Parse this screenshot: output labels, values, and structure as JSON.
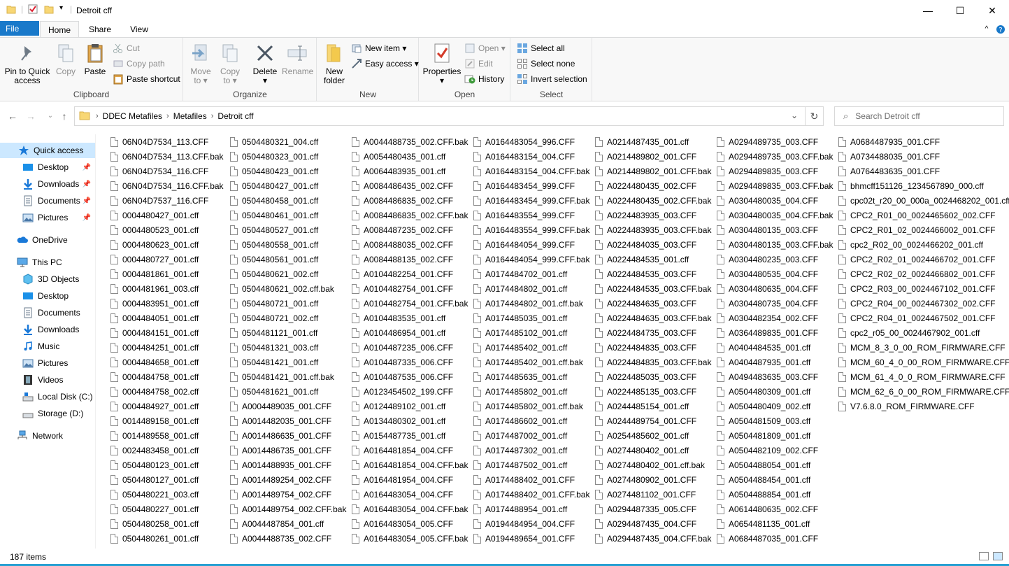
{
  "window": {
    "title": "Detroit cff",
    "minimize": "—",
    "maximize": "☐",
    "close": "✕"
  },
  "tabs": {
    "file": "File",
    "home": "Home",
    "share": "Share",
    "view": "View"
  },
  "ribbon": {
    "clipboard": {
      "label": "Clipboard",
      "pin_line1": "Pin to Quick",
      "pin_line2": "access",
      "copy": "Copy",
      "paste": "Paste",
      "cut": "Cut",
      "copy_path": "Copy path",
      "paste_shortcut": "Paste shortcut"
    },
    "organize": {
      "label": "Organize",
      "move_to_line1": "Move",
      "move_to_line2": "to ▾",
      "copy_to_line1": "Copy",
      "copy_to_line2": "to ▾",
      "delete": "Delete",
      "delete_arrow": "▾",
      "rename": "Rename"
    },
    "new": {
      "label": "New",
      "new_folder_line1": "New",
      "new_folder_line2": "folder",
      "new_item": "New item ▾",
      "easy_access": "Easy access ▾"
    },
    "open": {
      "label": "Open",
      "properties": "Properties",
      "properties_arrow": "▾",
      "open": "Open ▾",
      "edit": "Edit",
      "history": "History"
    },
    "select": {
      "label": "Select",
      "select_all": "Select all",
      "select_none": "Select none",
      "invert_selection": "Invert selection"
    }
  },
  "address": {
    "crumbs": [
      "DDEC Metafiles",
      "Metafiles",
      "Detroit cff"
    ]
  },
  "search": {
    "placeholder": "Search Detroit cff"
  },
  "nav": {
    "quick_access": "Quick access",
    "desktop": "Desktop",
    "downloads": "Downloads",
    "documents": "Documents",
    "pictures": "Pictures",
    "onedrive": "OneDrive",
    "this_pc": "This PC",
    "objects3d": "3D Objects",
    "desktop2": "Desktop",
    "documents2": "Documents",
    "downloads2": "Downloads",
    "music": "Music",
    "pictures2": "Pictures",
    "videos": "Videos",
    "local_disk": "Local Disk (C:)",
    "storage": "Storage (D:)",
    "network": "Network"
  },
  "files": [
    [
      "06N04D7534_113.CFF",
      "06N04D7534_113.CFF.bak",
      "06N04D7534_116.CFF",
      "06N04D7534_116.CFF.bak",
      "06N04D7537_116.CFF",
      "0004480427_001.cff",
      "0004480523_001.cff",
      "0004480623_001.cff",
      "0004480727_001.cff",
      "0004481861_001.cff",
      "0004481961_003.cff",
      "0004483951_001.cff",
      "0004484051_001.cff",
      "0004484151_001.cff",
      "0004484251_001.cff",
      "0004484658_001.cff",
      "0004484758_001.cff",
      "0004484758_002.cff",
      "0004484927_001.cff",
      "0014489158_001.cff",
      "0014489558_001.cff",
      "0024483458_001.cff",
      "0504480123_001.cff",
      "0504480127_001.cff",
      "0504480221_003.cff",
      "0504480227_001.cff",
      "0504480258_001.cff",
      "0504480261_001.cff"
    ],
    [
      "0504480321_004.cff",
      "0504480323_001.cff",
      "0504480423_001.cff",
      "0504480427_001.cff",
      "0504480458_001.cff",
      "0504480461_001.cff",
      "0504480527_001.cff",
      "0504480558_001.cff",
      "0504480561_001.cff",
      "0504480621_002.cff",
      "0504480621_002.cff.bak",
      "0504480721_001.cff",
      "0504480721_002.cff",
      "0504481121_001.cff",
      "0504481321_003.cff",
      "0504481421_001.cff",
      "0504481421_001.cff.bak",
      "0504481621_001.cff",
      "A0004489035_001.CFF",
      "A0014482035_001.CFF",
      "A0014486635_001.CFF",
      "A0014486735_001.CFF",
      "A0014488935_001.CFF",
      "A0014489254_002.CFF",
      "A0014489754_002.CFF",
      "A0014489754_002.CFF.bak",
      "A0044487854_001.cff",
      "A0044488735_002.CFF"
    ],
    [
      "A0044488735_002.CFF.bak",
      "A0054480435_001.cff",
      "A0064483935_001.cff",
      "A0084486435_002.CFF",
      "A0084486835_002.CFF",
      "A0084486835_002.CFF.bak",
      "A0084487235_002.CFF",
      "A0084488035_002.CFF",
      "A0084488135_002.CFF",
      "A0104482254_001.CFF",
      "A0104482754_001.CFF",
      "A0104482754_001.CFF.bak",
      "A0104483535_001.cff",
      "A0104486954_001.cff",
      "A0104487235_006.CFF",
      "A0104487335_006.CFF",
      "A0104487535_006.CFF",
      "A0123454502_199.CFF",
      "A0124489102_001.cff",
      "A0134480302_001.cff",
      "A0154487735_001.cff",
      "A0164481854_004.CFF",
      "A0164481854_004.CFF.bak",
      "A0164481954_004.CFF",
      "A0164483054_004.CFF",
      "A0164483054_004.CFF.bak",
      "A0164483054_005.CFF",
      "A0164483054_005.CFF.bak"
    ],
    [
      "A0164483054_996.CFF",
      "A0164483154_004.CFF",
      "A0164483154_004.CFF.bak",
      "A0164483454_999.CFF",
      "A0164483454_999.CFF.bak",
      "A0164483554_999.CFF",
      "A0164483554_999.CFF.bak",
      "A0164484054_999.CFF",
      "A0164484054_999.CFF.bak",
      "A0174484702_001.cff",
      "A0174484802_001.cff",
      "A0174484802_001.cff.bak",
      "A0174485035_001.cff",
      "A0174485102_001.cff",
      "A0174485402_001.cff",
      "A0174485402_001.cff.bak",
      "A0174485635_001.cff",
      "A0174485802_001.cff",
      "A0174485802_001.cff.bak",
      "A0174486602_001.cff",
      "A0174487002_001.cff",
      "A0174487302_001.cff",
      "A0174487502_001.cff",
      "A0174488402_001.CFF",
      "A0174488402_001.CFF.bak",
      "A0174488954_001.cff",
      "A0194484954_004.CFF",
      "A0194489654_001.CFF"
    ],
    [
      "A0214487435_001.cff",
      "A0214489802_001.CFF",
      "A0214489802_001.CFF.bak",
      "A0224480435_002.CFF",
      "A0224480435_002.CFF.bak",
      "A0224483935_003.CFF",
      "A0224483935_003.CFF.bak",
      "A0224484035_003.CFF",
      "A0224484535_001.cff",
      "A0224484535_003.CFF",
      "A0224484535_003.CFF.bak",
      "A0224484635_003.CFF",
      "A0224484635_003.CFF.bak",
      "A0224484735_003.CFF",
      "A0224484835_003.CFF",
      "A0224484835_003.CFF.bak",
      "A0224485035_003.CFF",
      "A0224485135_003.CFF",
      "A0244485154_001.cff",
      "A0244489754_001.CFF",
      "A0254485602_001.cff",
      "A0274480402_001.cff",
      "A0274480402_001.cff.bak",
      "A0274480902_001.CFF",
      "A0274481102_001.CFF",
      "A0294487335_005.CFF",
      "A0294487435_004.CFF",
      "A0294487435_004.CFF.bak"
    ],
    [
      "A0294489735_003.CFF",
      "A0294489735_003.CFF.bak",
      "A0294489835_003.CFF",
      "A0294489835_003.CFF.bak",
      "A0304480035_004.CFF",
      "A0304480035_004.CFF.bak",
      "A0304480135_003.CFF",
      "A0304480135_003.CFF.bak",
      "A0304480235_003.CFF",
      "A0304480535_004.CFF",
      "A0304480635_004.CFF",
      "A0304480735_004.CFF",
      "A0304482354_002.CFF",
      "A0364489835_001.CFF",
      "A0404484535_001.cff",
      "A0404487935_001.cff",
      "A0494483635_003.CFF",
      "A0504480309_001.cff",
      "A0504480409_002.cff",
      "A0504481509_003.cff",
      "A0504481809_001.cff",
      "A0504482109_002.CFF",
      "A0504488054_001.cff",
      "A0504488454_001.cff",
      "A0504488854_001.cff",
      "A0614480635_002.CFF",
      "A0654481135_001.cff",
      "A0684487035_001.CFF"
    ],
    [
      "A0684487935_001.CFF",
      "A0734488035_001.CFF",
      "A0764483635_001.CFF",
      "bhmcff151126_1234567890_000.cff",
      "cpc02t_r20_00_000a_0024468202_001.cff",
      "CPC2_R01_00_0024465602_002.CFF",
      "CPC2_R01_02_0024466002_001.CFF",
      "cpc2_R02_00_0024466202_001.cff",
      "CPC2_R02_01_0024466702_001.CFF",
      "CPC2_R02_02_0024466802_001.CFF",
      "CPC2_R03_00_0024467102_001.CFF",
      "CPC2_R04_00_0024467302_002.CFF",
      "CPC2_R04_01_0024467502_001.CFF",
      "cpc2_r05_00_0024467902_001.cff",
      "MCM_8_3_0_00_ROM_FIRMWARE.CFF",
      "MCM_60_4_0_00_ROM_FIRMWARE.CFF",
      "MCM_61_4_0_0_ROM_FIRMWARE.CFF",
      "MCM_62_6_0_00_ROM_FIRMWARE.CFF",
      "V7.6.8.0_ROM_FIRMWARE.CFF"
    ]
  ],
  "status": {
    "count": "187 items"
  }
}
